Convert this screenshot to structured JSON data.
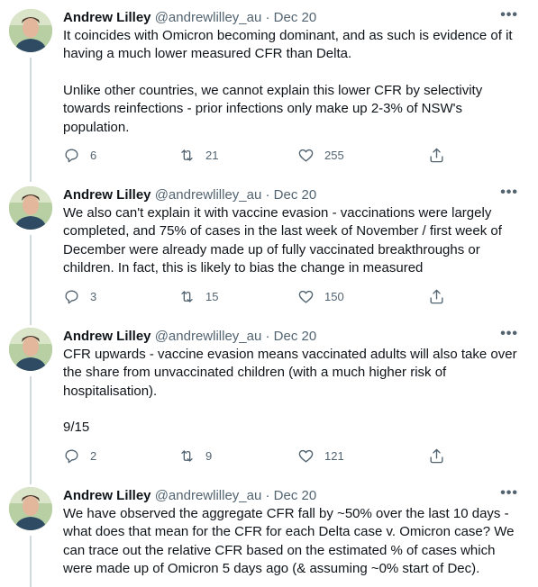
{
  "tweets": [
    {
      "author": "Andrew Lilley",
      "handle": "@andrewlilley_au",
      "date": "Dec 20",
      "paragraphs": [
        "It coincides with Omicron becoming dominant, and as such is evidence of it having a much lower measured CFR than Delta.",
        "Unlike other countries, we cannot explain this lower CFR by selectivity towards reinfections - prior infections only make up 2-3% of NSW's population."
      ],
      "replies": "6",
      "retweets": "21",
      "likes": "255"
    },
    {
      "author": "Andrew Lilley",
      "handle": "@andrewlilley_au",
      "date": "Dec 20",
      "paragraphs": [
        "We also can't explain it with vaccine evasion - vaccinations were largely completed, and 75% of cases in the last week of November / first week of December were already made up of fully vaccinated breakthroughs or children. In fact, this is likely to bias the change in measured"
      ],
      "replies": "3",
      "retweets": "15",
      "likes": "150"
    },
    {
      "author": "Andrew Lilley",
      "handle": "@andrewlilley_au",
      "date": "Dec 20",
      "paragraphs": [
        "CFR upwards - vaccine evasion means vaccinated adults will also take over the share from unvaccinated children (with a much higher risk of hospitalisation).",
        "9/15"
      ],
      "replies": "2",
      "retweets": "9",
      "likes": "121"
    },
    {
      "author": "Andrew Lilley",
      "handle": "@andrewlilley_au",
      "date": "Dec 20",
      "paragraphs": [
        "We have observed the aggregate CFR fall by ~50% over the last 10 days - what does that mean for the CFR for each Delta case v. Omicron case? We can trace out the relative CFR based on the estimated % of cases which were made up of Omicron 5 days ago (& assuming ~0% start of Dec)."
      ]
    }
  ],
  "separator": "·",
  "icons": {
    "more": "more-dots-icon",
    "reply": "reply-icon",
    "retweet": "retweet-icon",
    "like": "heart-icon",
    "share": "share-icon"
  },
  "colors": {
    "text": "#0f1419",
    "secondary": "#536471",
    "thread_line": "#cfd9de"
  }
}
